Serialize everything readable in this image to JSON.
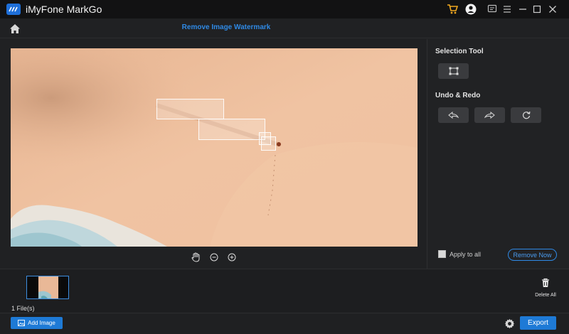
{
  "app": {
    "title": "iMyFone MarkGo",
    "accent": "#1e7ad6"
  },
  "header": {
    "title": "Remove Image Watermark"
  },
  "panel": {
    "selection_tool_label": "Selection Tool",
    "undo_redo_label": "Undo & Redo",
    "apply_to_all_label": "Apply to all",
    "apply_to_all_checked": false,
    "remove_now_label": "Remove Now"
  },
  "files": {
    "count_label": "1 File(s)",
    "delete_all_label": "Delete All"
  },
  "bottom": {
    "add_image_label": "Add Image",
    "export_label": "Export"
  },
  "icons": [
    "cart-icon",
    "user-icon",
    "feedback-icon",
    "menu-icon",
    "minimize-icon",
    "maximize-icon",
    "close-icon",
    "home-icon",
    "rectangle-select-icon",
    "undo-icon",
    "redo-icon",
    "reset-icon",
    "hand-icon",
    "zoom-out-icon",
    "zoom-in-icon",
    "trash-icon",
    "image-icon",
    "gear-icon"
  ]
}
